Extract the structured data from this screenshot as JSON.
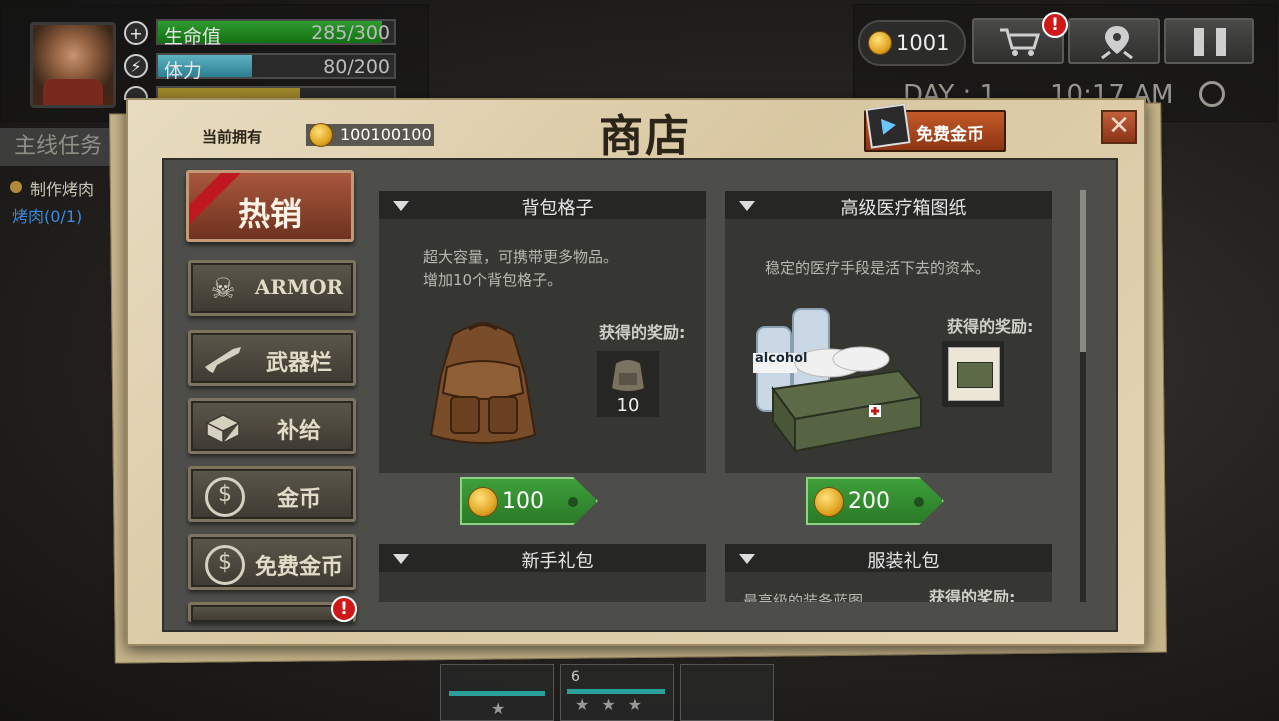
{
  "hud": {
    "hp_label": "生命值",
    "hp_value": "285/300",
    "hp_fraction": 0.95,
    "stamina_label": "体力",
    "stamina_value": "80/200",
    "stamina_fraction": 0.4,
    "quest_title": "主线任务",
    "quest_item": "制作烤肉",
    "quest_progress": "烤肉(0/1)",
    "coins": "1001",
    "day": "DAY : 1",
    "time": "10:17 AM",
    "stat_icons": [
      "plus-icon",
      "lightning-icon",
      "food-icon"
    ]
  },
  "shop": {
    "title": "商店",
    "owned_label": "当前拥有",
    "owned_value": "100100100",
    "free_coins_button": "免费金币",
    "close_symbol": "✕",
    "tabs": [
      {
        "label": "热销",
        "icon": "hot-ribbon-icon"
      },
      {
        "label": "ARMOR",
        "icon": "gas-mask-icon"
      },
      {
        "label": "武器栏",
        "icon": "rifle-icon"
      },
      {
        "label": "补给",
        "icon": "supply-box-icon"
      },
      {
        "label": "金币",
        "icon": "dollar-coin-icon"
      },
      {
        "label": "免费金币",
        "icon": "dollar-coin-icon"
      }
    ],
    "tab_badge": "!",
    "cards": [
      {
        "title": "背包格子",
        "desc1": "超大容量，可携带更多物品。",
        "desc2": "增加10个背包格子。",
        "reward_label": "获得的奖励:",
        "reward_count": "10",
        "price": "100"
      },
      {
        "title": "高级医疗箱图纸",
        "desc1": "稳定的医疗手段是活下去的资本。",
        "desc2": "",
        "reward_label": "获得的奖励:",
        "reward_count": "",
        "price": "200",
        "bottle_label": "alcohol"
      },
      {
        "title": "新手礼包"
      },
      {
        "title": "服装礼包",
        "desc1": "最高级的装备蓝图",
        "reward_label": "获得的奖励:"
      }
    ]
  },
  "bottom": {
    "slot_count": "6"
  },
  "colors": {
    "hp": "#1f8a1f",
    "stamina": "#3f8fa0",
    "hot_tab": "#8c4430",
    "price_tag": "#35902f",
    "badge": "#d11818"
  }
}
